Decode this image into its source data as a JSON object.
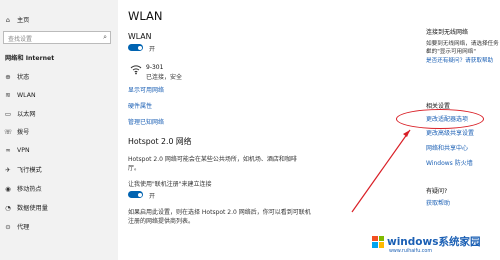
{
  "sidebar": {
    "home": "主页",
    "search_placeholder": "查找设置",
    "section": "网络和 Internet",
    "items": [
      {
        "label": "状态",
        "icon": "globe-icon"
      },
      {
        "label": "WLAN",
        "icon": "wifi-icon"
      },
      {
        "label": "以太网",
        "icon": "ethernet-icon"
      },
      {
        "label": "拨号",
        "icon": "phone-icon"
      },
      {
        "label": "VPN",
        "icon": "vpn-icon"
      },
      {
        "label": "飞行模式",
        "icon": "airplane-icon"
      },
      {
        "label": "移动热点",
        "icon": "hotspot-icon"
      },
      {
        "label": "数据使用量",
        "icon": "data-usage-icon"
      },
      {
        "label": "代理",
        "icon": "proxy-icon"
      }
    ]
  },
  "main": {
    "title": "WLAN",
    "wlan_label": "WLAN",
    "wlan_toggle": "开",
    "network_name": "9-301",
    "network_status": "已连接，安全",
    "show_networks": "显示可用网络",
    "hardware": "硬件属性",
    "manage_networks": "管理已知网络",
    "hotspot_heading": "Hotspot 2.0 网络",
    "hotspot_desc_1": "Hotspot 2.0 网络可能会在某些公共场所，如机场、酒店和咖啡",
    "hotspot_desc_2": "厅。",
    "signup_label": "让我使用\"联机注册\"来建立连接",
    "signup_toggle": "开",
    "hotspot_note_1": "如果启用此设置，则在选择 Hotspot 2.0 网络后，你可以看到可联机",
    "hotspot_note_2": "注册的网络提供商列表。"
  },
  "right": {
    "connect_heading": "连接到无线网络",
    "connect_text_1": "如要到无线网络，请选择任务栏",
    "connect_text_2": "上的\"显示可用网络\"",
    "connect_link": "是否还有疑问？请获取帮助",
    "related_heading": "相关设置",
    "related_links": [
      "更改适配器选项",
      "更改高级共享设置",
      "网络和共享中心",
      "Windows 防火墙"
    ],
    "question_heading": "有疑问?",
    "help_link": "获取帮助"
  },
  "watermark": {
    "title": "windows系统家园",
    "url": "www.ruihaifu.com"
  }
}
